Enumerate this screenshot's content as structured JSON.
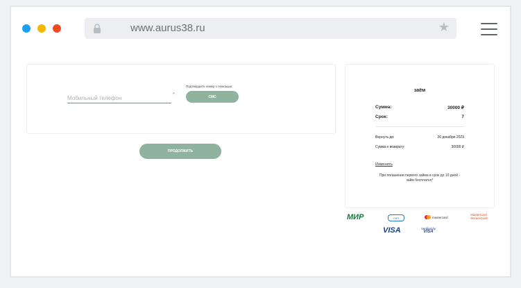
{
  "browser": {
    "url": "www.aurus38.ru",
    "dot_colors": [
      "#1ca0f2",
      "#f5b800",
      "#f04a23"
    ]
  },
  "form": {
    "phone_placeholder": "Мобильный телефон",
    "required_mark": "*",
    "confirm_label": "Подтвердите номер с помощью:",
    "sms_label": "СМС",
    "continue_label": "ПРОДОЛЖИТЬ"
  },
  "loan": {
    "title": "заём",
    "amount_label": "Сумма:",
    "amount_value": "30000 ₽",
    "term_label": "Срок:",
    "term_value": "7",
    "return_by_label": "Вернуть до:",
    "return_by_value": "26 декабря 2023",
    "to_return_label": "Сумма к возврату:",
    "to_return_value": "30000 ₽",
    "change_label": "Изменить",
    "note": "При погашении первого займа в срок до 10 дней - займ бесплатно*"
  },
  "payment_logos": {
    "mir": "МИР",
    "sbp": "СБП",
    "mastercard": "mastercard",
    "mc_securecode_1": "MasterCard.",
    "mc_securecode_2": "SecureCode",
    "visa": "VISA",
    "vbv_1": "Verified by",
    "vbv_2": "VISA"
  },
  "colors": {
    "accent": "#8fb39f",
    "required": "#e0524a"
  }
}
